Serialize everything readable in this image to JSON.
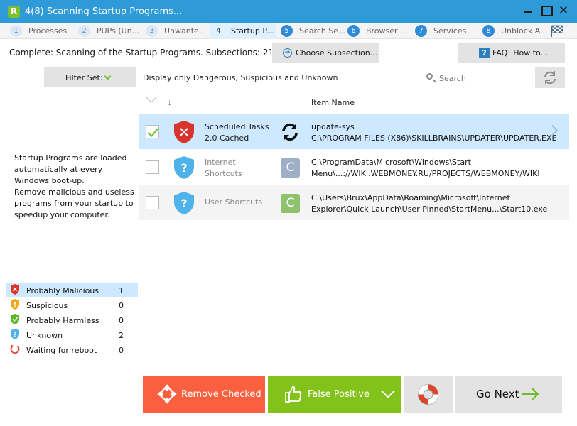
{
  "window": {
    "title": "4(8) Scanning Startup Programs...",
    "logo_letter": "R"
  },
  "steps": [
    {
      "num": "1",
      "label": "Processes",
      "state": "done"
    },
    {
      "num": "2",
      "label": "PUPs (Un...",
      "state": "done"
    },
    {
      "num": "3",
      "label": "Unwante...",
      "state": "done"
    },
    {
      "num": "4",
      "label": "Startup P...",
      "state": "active"
    },
    {
      "num": "5",
      "label": "Search Se...",
      "state": "upcoming"
    },
    {
      "num": "6",
      "label": "Browser ...",
      "state": "upcoming"
    },
    {
      "num": "7",
      "label": "Services",
      "state": "upcoming"
    },
    {
      "num": "8",
      "label": "Unblock A...",
      "state": "upcoming"
    }
  ],
  "header": {
    "status": "Complete: Scanning of the Startup Programs. Subsections: 21",
    "choose_subsection": "Choose Subsection...",
    "faq": "FAQ! How to..."
  },
  "filter": {
    "label": "Filter Set:",
    "description": "Display only Dangerous, Suspicious and Unknown",
    "search_placeholder": "Search"
  },
  "table": {
    "column_item_name": "Item Name",
    "rows": [
      {
        "checked": true,
        "status": "malicious",
        "category_line1": "Scheduled Tasks",
        "category_line2": "2.0 Cached",
        "source_icon": "sync-icon",
        "name_line1": "update-sys",
        "name_line2": "C:\\PROGRAM FILES (X86)\\SKILLBRAINS\\UPDATER\\UPDATER.EXE"
      },
      {
        "checked": false,
        "status": "unknown",
        "category_line1": "Internet",
        "category_line2": "Shortcuts",
        "source_icon": "c-icon",
        "source_letter": "C",
        "name_line1": "C:\\ProgramData\\Microsoft\\Windows\\Start",
        "name_line2": "Menu\\...://WIKI.WEBMONEY.RU/PROJECTS/WEBMONEY/WIKI"
      },
      {
        "checked": false,
        "status": "unknown",
        "category_line1": "User Shortcuts",
        "category_line2": "",
        "source_icon": "c-icon",
        "source_letter": "C",
        "name_line1": "C:\\Users\\Brux\\AppData\\Roaming\\Microsoft\\Internet",
        "name_line2": "Explorer\\Quick Launch\\User Pinned\\StartMenu...\\Start10.exe"
      }
    ]
  },
  "info": {
    "line1": "Startup Programs are loaded automatically at every Windows boot-up.",
    "line2": "Remove malicious and useless programs from your startup to speedup your computer."
  },
  "legend": [
    {
      "label": "Probably Malicious",
      "count": "1",
      "icon": "red-shield-icon"
    },
    {
      "label": "Suspicious",
      "count": "0",
      "icon": "orange-shield-icon"
    },
    {
      "label": "Probably Harmless",
      "count": "0",
      "icon": "green-shield-icon"
    },
    {
      "label": "Unknown",
      "count": "2",
      "icon": "blue-shield-icon"
    },
    {
      "label": "Waiting for reboot",
      "count": "0",
      "icon": "reboot-icon"
    }
  ],
  "footer": {
    "remove_checked": "Remove Checked",
    "false_positive": "False Positive",
    "go_next": "Go Next"
  },
  "colors": {
    "titlebar": "#2e9ad8",
    "remove": "#fa6040",
    "false_positive": "#83c21a",
    "malicious": "#d9342b",
    "unknown": "#4fb2e8",
    "selected_row": "#cde8ff"
  }
}
